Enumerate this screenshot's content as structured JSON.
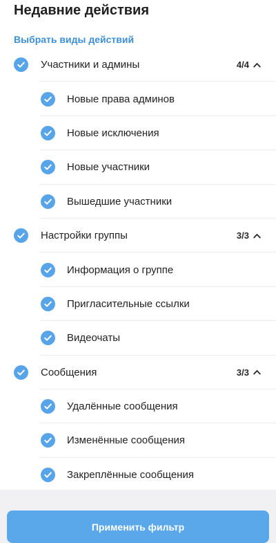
{
  "header": {
    "title": "Недавние действия",
    "subtitle": "Выбрать виды действий"
  },
  "accent_color": "#57a4e8",
  "groups": [
    {
      "label": "Участники и админы",
      "counter": "4/4",
      "checked": true,
      "items": [
        {
          "label": "Новые права админов",
          "checked": true
        },
        {
          "label": "Новые исключения",
          "checked": true
        },
        {
          "label": "Новые участники",
          "checked": true
        },
        {
          "label": "Вышедшие участники",
          "checked": true
        }
      ]
    },
    {
      "label": "Настройки группы",
      "counter": "3/3",
      "checked": true,
      "items": [
        {
          "label": "Информация о группе",
          "checked": true
        },
        {
          "label": "Пригласительные ссылки",
          "checked": true
        },
        {
          "label": "Видеочаты",
          "checked": true
        }
      ]
    },
    {
      "label": "Сообщения",
      "counter": "3/3",
      "checked": true,
      "items": [
        {
          "label": "Удалённые сообщения",
          "checked": true
        },
        {
          "label": "Изменённые сообщения",
          "checked": true
        },
        {
          "label": "Закреплённые сообщения",
          "checked": true
        }
      ]
    }
  ],
  "footer": {
    "apply_label": "Применить фильтр"
  }
}
